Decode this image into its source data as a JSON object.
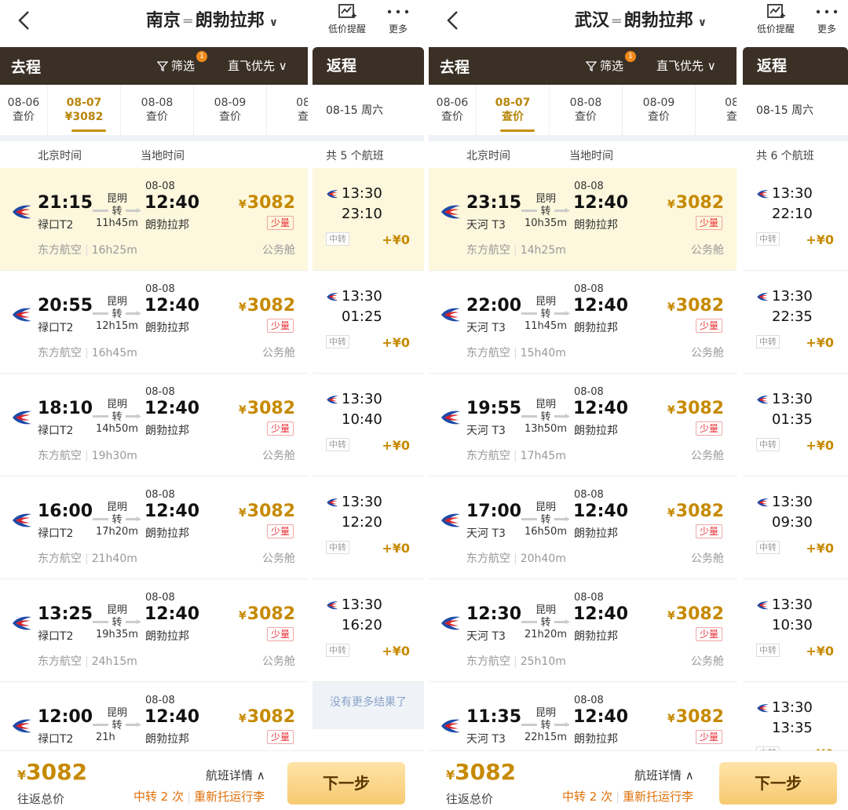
{
  "common": {
    "low_price_alert": "低价提醒",
    "more": "更多",
    "outbound_label": "去程",
    "filter_label": "筛选",
    "filter_badge": "1",
    "sort_label": "直飞优先",
    "return_label": "返程",
    "beijing_time": "北京时间",
    "local_time": "当地时间",
    "no_more": "没有更多结果了",
    "transfer_tag": "中转",
    "few_left": "少量",
    "cabin": "公务舱",
    "airline": "东方航空",
    "via_city": "昆明",
    "via_word": "转",
    "arrival_date": "08-08",
    "arrival_time": "12:40",
    "arrival_airport": "朗勃拉邦",
    "currency": "¥",
    "footer": {
      "total": "3082",
      "total_label": "往返总价",
      "detail": "航班详情",
      "transfers": "中转 2 次",
      "recheck": "重新托运行李",
      "next": "下一步"
    },
    "colors": {
      "accent": "#c68a00",
      "header_bg": "#3b3026",
      "highlight": "#fdf7dd",
      "sold_red": "#e8333a"
    }
  },
  "panels": [
    {
      "origin": "南京",
      "destination": "朗勃拉邦",
      "dates": [
        {
          "date": "08-06",
          "value": "查价"
        },
        {
          "date": "08-07",
          "value": "¥3082",
          "selected": true
        },
        {
          "date": "08-08",
          "value": "查价"
        },
        {
          "date": "08-09",
          "value": "查价"
        },
        {
          "date": "08",
          "value": "查"
        }
      ],
      "return_date": "08-15 周六",
      "return_count": "共 5 个航班",
      "flights": [
        {
          "dep": "21:15",
          "dep_ap": "禄口T2",
          "dur": "11h45m",
          "price": "3082",
          "total": "16h25m"
        },
        {
          "dep": "20:55",
          "dep_ap": "禄口T2",
          "dur": "12h15m",
          "price": "3082",
          "total": "16h45m"
        },
        {
          "dep": "18:10",
          "dep_ap": "禄口T2",
          "dur": "14h50m",
          "price": "3082",
          "total": "19h30m"
        },
        {
          "dep": "16:00",
          "dep_ap": "禄口T2",
          "dur": "17h20m",
          "price": "3082",
          "total": "21h40m"
        },
        {
          "dep": "13:25",
          "dep_ap": "禄口T2",
          "dur": "19h35m",
          "price": "3082",
          "total": "24h15m"
        },
        {
          "dep": "12:00",
          "dep_ap": "禄口T2",
          "dur": "21h",
          "price": "3082",
          "total": ""
        }
      ],
      "returns": [
        {
          "dep": "13:30",
          "arr": "23:10",
          "add": "+¥0"
        },
        {
          "dep": "13:30",
          "arr": "01:25",
          "add": "+¥0"
        },
        {
          "dep": "13:30",
          "arr": "10:40",
          "add": "+¥0"
        },
        {
          "dep": "13:30",
          "arr": "12:20",
          "add": "+¥0"
        },
        {
          "dep": "13:30",
          "arr": "16:20",
          "add": "+¥0"
        }
      ]
    },
    {
      "origin": "武汉",
      "destination": "朗勃拉邦",
      "dates": [
        {
          "date": "08-06",
          "value": "查价"
        },
        {
          "date": "08-07",
          "value": "查价",
          "selected": true
        },
        {
          "date": "08-08",
          "value": "查价"
        },
        {
          "date": "08-09",
          "value": "查价"
        },
        {
          "date": "08",
          "value": "查"
        }
      ],
      "return_date": "08-15 周六",
      "return_count": "共 6 个航班",
      "flights": [
        {
          "dep": "23:15",
          "dep_ap": "天河 T3",
          "dur": "10h35m",
          "price": "3082",
          "total": "14h25m"
        },
        {
          "dep": "22:00",
          "dep_ap": "天河 T3",
          "dur": "11h45m",
          "price": "3082",
          "total": "15h40m"
        },
        {
          "dep": "19:55",
          "dep_ap": "天河 T3",
          "dur": "13h50m",
          "price": "3082",
          "total": "17h45m"
        },
        {
          "dep": "17:00",
          "dep_ap": "天河 T3",
          "dur": "16h50m",
          "price": "3082",
          "total": "20h40m"
        },
        {
          "dep": "12:30",
          "dep_ap": "天河 T3",
          "dur": "21h20m",
          "price": "3082",
          "total": "25h10m"
        },
        {
          "dep": "11:35",
          "dep_ap": "天河 T3",
          "dur": "22h15m",
          "price": "3082",
          "total": ""
        }
      ],
      "returns": [
        {
          "dep": "13:30",
          "arr": "22:10",
          "add": "+¥0"
        },
        {
          "dep": "13:30",
          "arr": "22:35",
          "add": "+¥0"
        },
        {
          "dep": "13:30",
          "arr": "01:35",
          "add": "+¥0"
        },
        {
          "dep": "13:30",
          "arr": "09:30",
          "add": "+¥0"
        },
        {
          "dep": "13:30",
          "arr": "10:30",
          "add": "+¥0"
        },
        {
          "dep": "13:30",
          "arr": "13:35",
          "add": "+¥0"
        }
      ]
    }
  ]
}
